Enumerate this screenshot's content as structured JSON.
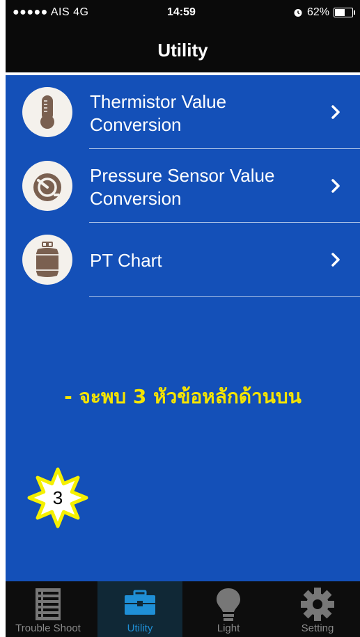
{
  "status_bar": {
    "carrier": "●●●●● AIS  4G",
    "time": "14:59",
    "battery": "62%",
    "battery_level": 0.62
  },
  "header": {
    "title": "Utility"
  },
  "menu": {
    "items": [
      {
        "label": "Thermistor Value Conversion",
        "icon": "thermometer-icon"
      },
      {
        "label": "Pressure Sensor Value Conversion",
        "icon": "pressure-gauge-icon"
      },
      {
        "label": "PT Chart",
        "icon": "gas-tank-icon"
      }
    ]
  },
  "annotation": {
    "caption": "- จะพบ 3 หัวข้อหลักด้านบน",
    "badge_number": "3"
  },
  "tabs": [
    {
      "label": "Trouble Shoot",
      "icon": "checklist-icon",
      "active": false
    },
    {
      "label": "Utility",
      "icon": "toolbox-icon",
      "active": true
    },
    {
      "label": "Light",
      "icon": "lightbulb-icon",
      "active": false
    },
    {
      "label": "Setting",
      "icon": "gear-icon",
      "active": false
    }
  ],
  "colors": {
    "background": "#1450b8",
    "caption": "#f5e400",
    "tab_active": "#1f8fd6",
    "icon_brown": "#7a6050"
  }
}
